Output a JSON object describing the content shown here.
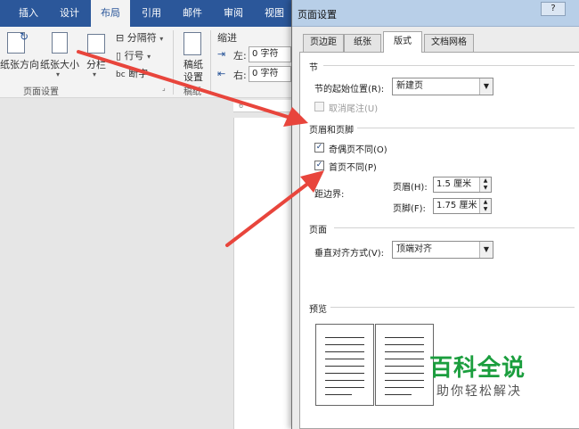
{
  "ribbon": {
    "tabs": [
      "插入",
      "设计",
      "布局",
      "引用",
      "邮件",
      "审阅",
      "视图"
    ],
    "active_tab": "布局",
    "orientation_label": "纸张方向",
    "size_label": "纸张大小",
    "columns_label": "分栏",
    "breaks_label": "分隔符",
    "line_numbers_label": "行号",
    "hyphenation_label": "断字",
    "page_setup_group": "页面设置",
    "draft_label_1": "稿纸",
    "draft_label_2": "设置",
    "draft_group": "稿纸",
    "indent_label": "缩进",
    "indent_left_label": "左:",
    "indent_left_value": "0 字符",
    "indent_right_label": "右:",
    "indent_right_value": "0 字符",
    "ruler_mark": "6"
  },
  "dialog": {
    "title": "页面设置",
    "help": "?",
    "tabs": [
      "页边距",
      "纸张",
      "版式",
      "文档网格"
    ],
    "active_tab": "版式",
    "section": {
      "heading": "节",
      "start_label": "节的起始位置(R):",
      "start_value": "新建页",
      "suppress_endnotes": "取消尾注(U)"
    },
    "header_footer": {
      "heading": "页眉和页脚",
      "odd_even": "奇偶页不同(O)",
      "odd_even_checked": true,
      "first_page": "首页不同(P)",
      "first_page_checked": true,
      "from_edge": "距边界:",
      "header_label": "页眉(H):",
      "header_value": "1.5 厘米",
      "footer_label": "页脚(F):",
      "footer_value": "1.75 厘米"
    },
    "page": {
      "heading": "页面",
      "valign_label": "垂直对齐方式(V):",
      "valign_value": "顶端对齐"
    },
    "preview_heading": "预览"
  },
  "watermark": {
    "main": "百科全说",
    "sub": "助你轻松解决"
  },
  "colors": {
    "ribbon_blue": "#2b579a",
    "annotation_red": "#e8453c",
    "watermark_green": "#1b9e3e"
  }
}
